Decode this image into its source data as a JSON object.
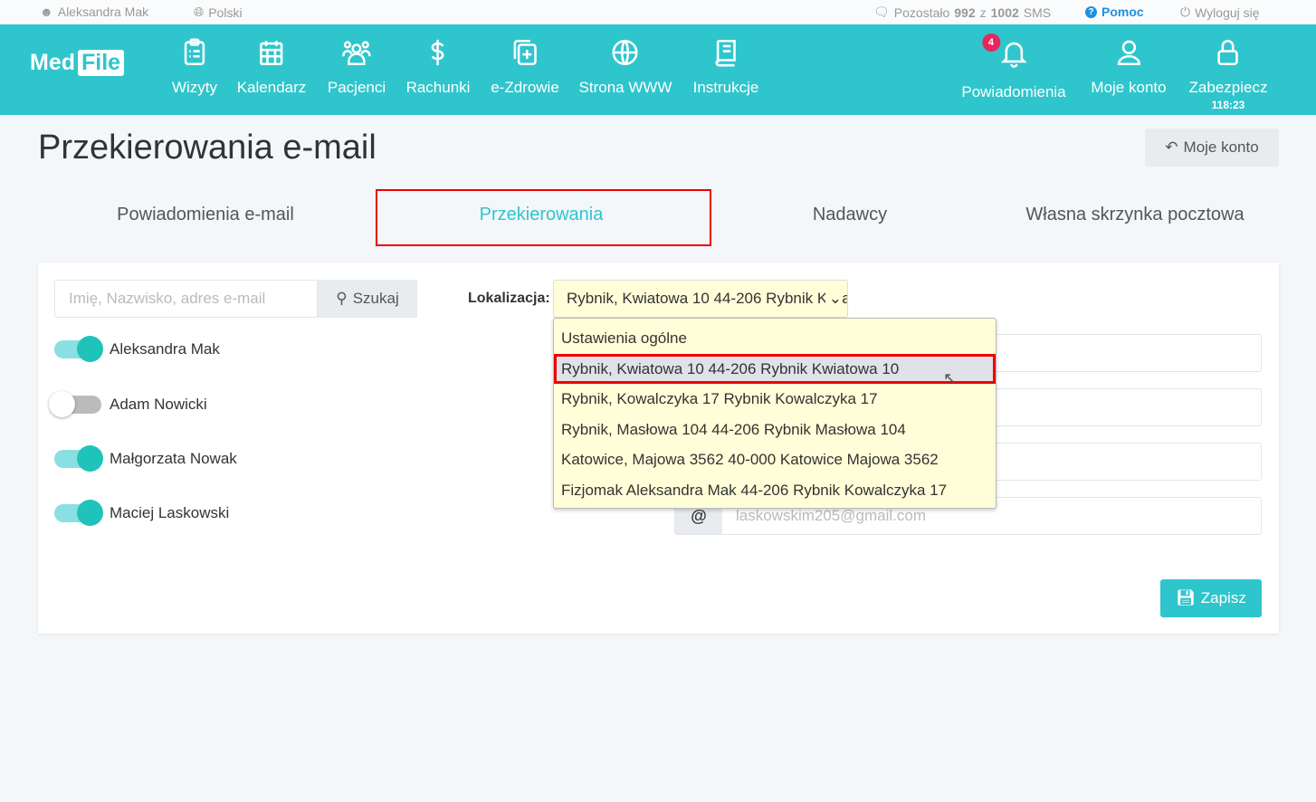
{
  "topbar": {
    "user": "Aleksandra Mak",
    "language": "Polski",
    "sms_prefix": "Pozostało ",
    "sms_used": "992",
    "sms_mid": " z ",
    "sms_total": "1002",
    "sms_suffix": " SMS",
    "help": "Pomoc",
    "logout": "Wyloguj się"
  },
  "nav": {
    "logo_a": "Med",
    "logo_b": "File",
    "items": [
      {
        "label": "Wizyty",
        "icon": "clipboard-icon"
      },
      {
        "label": "Kalendarz",
        "icon": "calendar-icon"
      },
      {
        "label": "Pacjenci",
        "icon": "users-icon"
      },
      {
        "label": "Rachunki",
        "icon": "dollar-icon"
      },
      {
        "label": "e-Zdrowie",
        "icon": "medical-icon"
      },
      {
        "label": "Strona WWW",
        "icon": "globe-icon"
      },
      {
        "label": "Instrukcje",
        "icon": "book-icon"
      }
    ],
    "notifications": "Powiadomienia",
    "notifications_count": "4",
    "account": "Moje konto",
    "lock": "Zabezpiecz",
    "timer": "118:23"
  },
  "page": {
    "title": "Przekierowania e-mail",
    "back": "Moje konto"
  },
  "tabs": [
    "Powiadomienia e-mail",
    "Przekierowania",
    "Nadawcy",
    "Własna skrzynka pocztowa"
  ],
  "active_tab": "Przekierowania",
  "search": {
    "placeholder": "Imię, Nazwisko, adres e-mail",
    "button": "Szukaj"
  },
  "users": [
    {
      "name": "Aleksandra Mak",
      "enabled": true
    },
    {
      "name": "Adam Nowicki",
      "enabled": false
    },
    {
      "name": "Małgorzata Nowak",
      "enabled": true
    },
    {
      "name": "Maciej Laskowski",
      "enabled": true
    }
  ],
  "location": {
    "label": "Lokalizacja:",
    "selected": "Rybnik, Kwiatowa 10 44-206 Rybnik Kwiatowa 10",
    "options": [
      "Ustawienia ogólne",
      "Rybnik, Kwiatowa 10 44-206 Rybnik Kwiatowa 10",
      "Rybnik, Kowalczyka 17 Rybnik Kowalczyka 17",
      "Rybnik, Masłowa 104 44-206 Rybnik Masłowa 104",
      "Katowice, Majowa 3562 40-000 Katowice Majowa 3562",
      "Fizjomak Aleksandra Mak 44-206 Rybnik Kowalczyka 17"
    ]
  },
  "emails": {
    "last_placeholder": "laskowskim205@gmail.com",
    "prefix": "@"
  },
  "save": "Zapisz",
  "colors": {
    "brand": "#2fc5cc",
    "badge": "#e8265d",
    "highlight": "#e00000"
  }
}
